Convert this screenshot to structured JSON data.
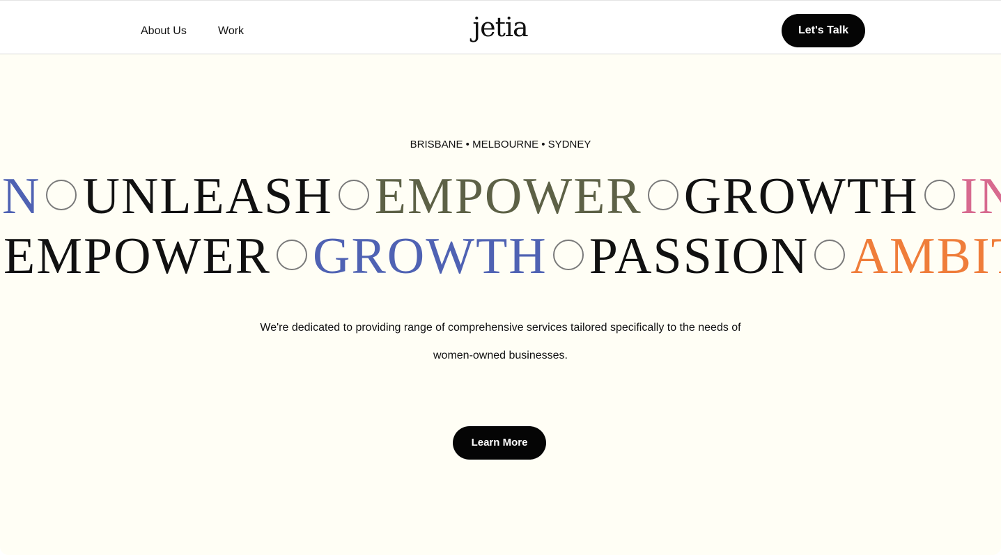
{
  "nav": {
    "about_label": "About Us",
    "work_label": "Work",
    "logo_text": "jetia",
    "cta_label": "Let's Talk"
  },
  "hero": {
    "cities": "BRISBANE • MELBOURNE • SYDNEY",
    "marquee_rows": [
      [
        {
          "text": "N",
          "color": "#4f62b3"
        },
        {
          "text": "UNLEASH",
          "color": "#111111"
        },
        {
          "text": "EMPOWER",
          "color": "#5d6146"
        },
        {
          "text": "GROWTH",
          "color": "#111111"
        },
        {
          "text": "IN",
          "color": "#d76a8f"
        }
      ],
      [
        {
          "text": "EMPOWER",
          "color": "#111111"
        },
        {
          "text": "GROWTH",
          "color": "#4f62b3"
        },
        {
          "text": "PASSION",
          "color": "#111111"
        },
        {
          "text": "AMBIT",
          "color": "#ef7d3a"
        }
      ]
    ],
    "tagline_line1": "We're dedicated to providing range of comprehensive services tailored specifically to the needs of",
    "tagline_line2": "women-owned businesses.",
    "cta_label": "Learn More"
  },
  "colors": {
    "background": "#fffef5",
    "header_background": "#ffffff",
    "button": "#050505",
    "button_text": "#ffffff"
  }
}
